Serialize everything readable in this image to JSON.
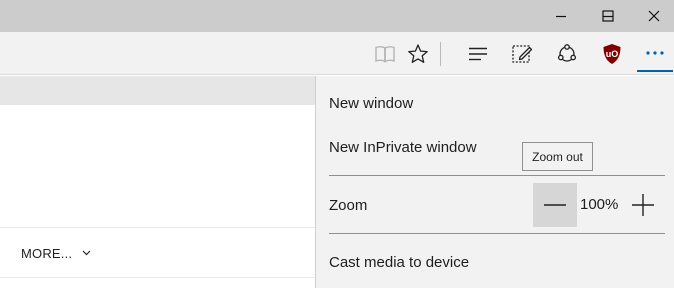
{
  "window_controls": {
    "minimize": "minimize-icon",
    "maximize": "maximize-icon",
    "close": "close-icon"
  },
  "toolbar": {
    "icons": [
      "reading-view-icon",
      "favorite-star-icon",
      "hub-icon",
      "web-note-icon",
      "share-icon",
      "ublock-origin-icon",
      "more-actions-icon"
    ],
    "accent_color": "#0063b1",
    "extension_color": "#800000"
  },
  "page": {
    "more_label": "MORE..."
  },
  "menu": {
    "new_window": "New window",
    "new_inprivate_window": "New InPrivate window",
    "zoom_label": "Zoom",
    "zoom_value": "100%",
    "cast_media": "Cast media to device"
  },
  "tooltip": {
    "text": "Zoom out"
  }
}
